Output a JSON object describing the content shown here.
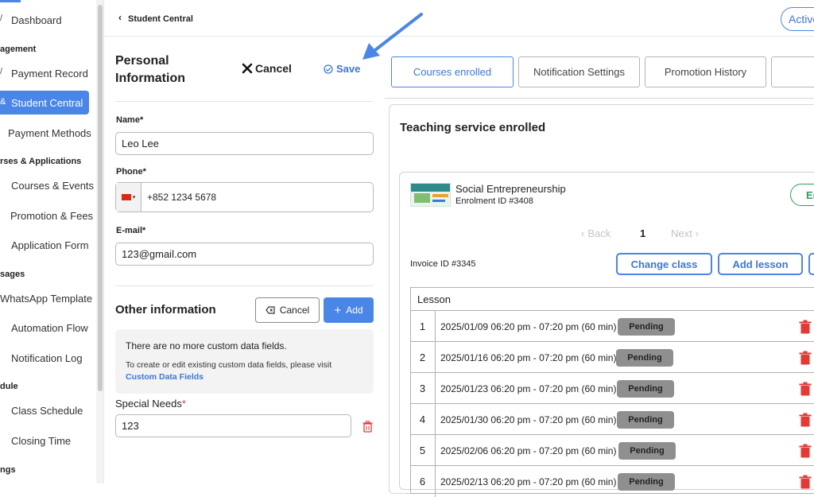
{
  "sidebar": {
    "items": [
      {
        "label": "Dashboard"
      },
      {
        "label": "Payment Record"
      },
      {
        "label": "Student Central"
      },
      {
        "label": "Payment Methods"
      },
      {
        "label": "Courses & Events"
      },
      {
        "label": "Promotion & Fees"
      },
      {
        "label": "Application Form"
      },
      {
        "label": "WhatsApp Template"
      },
      {
        "label": "Automation Flow"
      },
      {
        "label": "Notification Log"
      },
      {
        "label": "Class Schedule"
      },
      {
        "label": "Closing Time"
      }
    ],
    "headings": [
      "agement",
      "rses & Applications",
      "sages",
      "dule",
      "ngs"
    ]
  },
  "header": {
    "breadcrumb": "Student Central",
    "status_badge": "Active"
  },
  "personal": {
    "title_line1": "Personal",
    "title_line2": "Information",
    "cancel_label": "Cancel",
    "save_label": "Save",
    "name_label": "Name*",
    "name_value": "Leo Lee",
    "phone_label": "Phone*",
    "phone_value": "+852 1234 5678",
    "email_label": "E-mail*",
    "email_value": "123@gmail.com"
  },
  "other": {
    "title": "Other information",
    "cancel_label": "Cancel",
    "add_label": "Add",
    "empty_msg": "There are no more custom data fields.",
    "hint": "To create or edit existing custom data fields, please visit",
    "link": "Custom Data Fields",
    "special_label": "Special Needs",
    "special_required": "*",
    "special_value": "123"
  },
  "tabs": [
    {
      "label": "Courses enrolled"
    },
    {
      "label": "Notification Settings"
    },
    {
      "label": "Promotion History"
    }
  ],
  "service": {
    "title": "Teaching service enrolled",
    "course_name": "Social Entrepreneurship",
    "enrolment_id": "Enrolment ID #3408",
    "status_partial": "En",
    "pager_back": "Back",
    "pager_page": "1",
    "pager_next": "Next",
    "invoice_id": "Invoice ID #3345",
    "change_class": "Change class",
    "add_lesson": "Add lesson",
    "lesson_header": "Lesson"
  },
  "lessons": [
    {
      "num": "1",
      "time": "2025/01/09 06:20 pm - 07:20 pm (60 min)",
      "status": "Pending"
    },
    {
      "num": "2",
      "time": "2025/01/16 06:20 pm - 07:20 pm (60 min)",
      "status": "Pending"
    },
    {
      "num": "3",
      "time": "2025/01/23 06:20 pm - 07:20 pm (60 min)",
      "status": "Pending"
    },
    {
      "num": "4",
      "time": "2025/01/30 06:20 pm - 07:20 pm (60 min)",
      "status": "Pending"
    },
    {
      "num": "5",
      "time": "2025/02/06 06:20 pm - 07:20 pm (60 min)",
      "status": "Pending"
    },
    {
      "num": "6",
      "time": "2025/02/13 06:20 pm - 07:20 pm (60 min)",
      "status": "Pending"
    }
  ],
  "colors": {
    "accent": "#4a86e8",
    "danger": "#e53935",
    "pending": "#8f8f8f",
    "active_status": "#2e9e5b"
  }
}
